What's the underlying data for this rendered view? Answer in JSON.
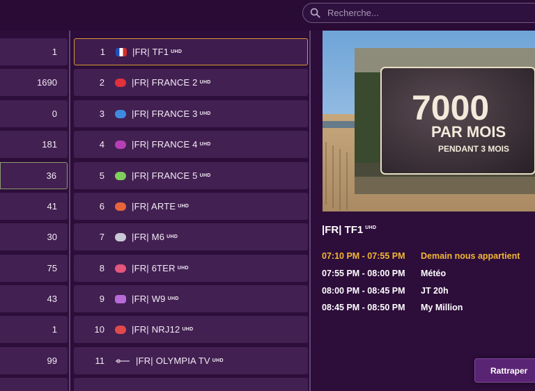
{
  "search": {
    "placeholder": "Recherche..."
  },
  "categories": [
    {
      "count": "1"
    },
    {
      "count": "1690"
    },
    {
      "count": "0"
    },
    {
      "count": "181"
    },
    {
      "count": "36"
    },
    {
      "count": "41"
    },
    {
      "count": "30"
    },
    {
      "count": "75"
    },
    {
      "count": "43"
    },
    {
      "count": "1"
    },
    {
      "count": "99"
    }
  ],
  "channels": [
    {
      "num": "1",
      "name": "|FR| TF1",
      "badge": "UHD",
      "logo": "tf1-logo-icon"
    },
    {
      "num": "2",
      "name": "|FR| FRANCE 2",
      "badge": "UHD",
      "logo": "france2-logo-icon"
    },
    {
      "num": "3",
      "name": "|FR| FRANCE 3",
      "badge": "UHD",
      "logo": "france3-logo-icon"
    },
    {
      "num": "4",
      "name": "|FR| FRANCE 4",
      "badge": "UHD",
      "logo": "france4-logo-icon"
    },
    {
      "num": "5",
      "name": "|FR| FRANCE 5",
      "badge": "UHD",
      "logo": "france5-logo-icon"
    },
    {
      "num": "6",
      "name": "|FR| ARTE",
      "badge": "UHD",
      "logo": "arte-logo-icon"
    },
    {
      "num": "7",
      "name": "|FR| M6",
      "badge": "UHD",
      "logo": "m6-logo-icon"
    },
    {
      "num": "8",
      "name": "|FR| 6TER",
      "badge": "UHD",
      "logo": "6ter-logo-icon"
    },
    {
      "num": "9",
      "name": "|FR| W9",
      "badge": "UHD",
      "logo": "w9-logo-icon"
    },
    {
      "num": "10",
      "name": "|FR| NRJ12",
      "badge": "UHD",
      "logo": "nrj12-logo-icon"
    },
    {
      "num": "11",
      "name": "|FR| OLYMPIA TV",
      "badge": "UHD",
      "logo": "olympia-logo-icon"
    }
  ],
  "preview": {
    "headline": "7000",
    "line2": "PAR MOIS",
    "line3": "PENDANT 3 MOIS"
  },
  "info": {
    "channel_title": "|FR| TF1",
    "badge": "UHD",
    "epg": [
      {
        "time": "07:10 PM - 07:55 PM",
        "title": "Demain nous appartient",
        "current": true
      },
      {
        "time": "07:55 PM - 08:00 PM",
        "title": "Météo"
      },
      {
        "time": "08:00 PM - 08:45 PM",
        "title": "JT 20h"
      },
      {
        "time": "08:45 PM - 08:50 PM",
        "title": "My Million"
      }
    ]
  },
  "actions": {
    "catchup_label": "Rattraper"
  },
  "colors": {
    "background": "#2d0d3a",
    "row": "#432052",
    "accent": "#f2b734",
    "focus_border": "#d69a32"
  }
}
